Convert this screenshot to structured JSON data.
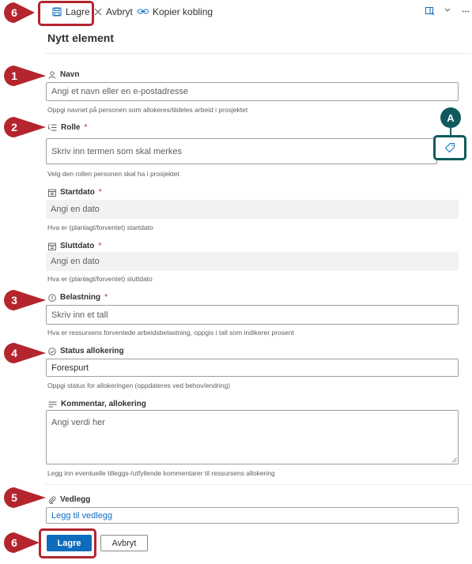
{
  "toolbar": {
    "save_label": "Lagre",
    "cancel_label": "Avbryt",
    "copy_link_label": "Kopier kobling"
  },
  "form": {
    "title": "Nytt element",
    "name": {
      "label": "Navn",
      "placeholder": "Angi et navn eller en e-postadresse",
      "help": "Oppgi navnet på personen som allokeres/tildeles arbeid i prosjektet"
    },
    "role": {
      "label": "Rolle",
      "required_mark": "*",
      "placeholder": "Skriv inn termen som skal merkes",
      "help": "Velg den rollen personen skal ha i prosjektet"
    },
    "start_date": {
      "label": "Startdato",
      "required_mark": "*",
      "placeholder": "Angi en dato",
      "help": "Hva er (planlagt/forventet) startdato"
    },
    "end_date": {
      "label": "Sluttdato",
      "required_mark": "*",
      "placeholder": "Angi en dato",
      "help": "Hva er (planlagt/forventet) sluttdato"
    },
    "load": {
      "label": "Belastning",
      "required_mark": "*",
      "placeholder": "Skriv inn et tall",
      "help": "Hva er ressursens forventede arbeidsbelastning, oppgis i tall som indikerer prosent"
    },
    "status": {
      "label": "Status allokering",
      "value": "Forespurt",
      "help": "Oppgi status for allokeringen (oppdateres ved behov/endring)"
    },
    "comment": {
      "label": "Kommentar, allokering",
      "placeholder": "Angi verdi her",
      "help": "Legg inn eventuelle tilleggs-/utfyllende kommentarer til ressursens allokering"
    },
    "attachments": {
      "label": "Vedlegg",
      "add_link": "Legg til vedlegg"
    },
    "save_button": "Lagre",
    "cancel_button": "Avbryt"
  },
  "callouts": {
    "c1": "1",
    "c2": "2",
    "c3": "3",
    "c4": "4",
    "c5": "5",
    "c6_top": "6",
    "c6_bottom": "6",
    "a": "A"
  },
  "colors": {
    "callout_red": "#b4252e",
    "callout_teal": "#0f5a5c",
    "accent_blue": "#0f6cbd"
  },
  "icons": [
    "save-icon",
    "close-icon",
    "link-icon",
    "panel-icon",
    "chevron-down-icon",
    "more-icon",
    "person-icon",
    "list-icon",
    "calendar-icon",
    "info-icon",
    "check-circle-icon",
    "text-lines-icon",
    "paperclip-icon",
    "tag-icon"
  ]
}
